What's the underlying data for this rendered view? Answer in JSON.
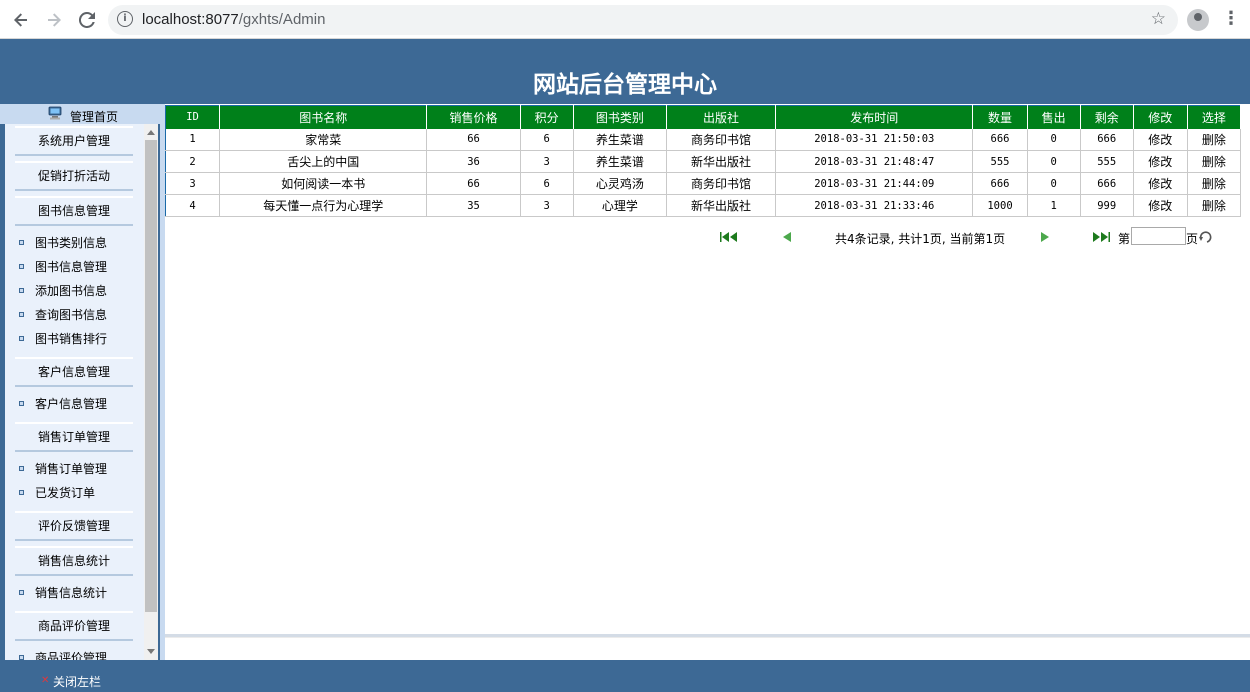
{
  "browser": {
    "url_host": "localhost:8077",
    "url_path": "/gxhts/Admin"
  },
  "header": {
    "title": "网站后台管理中心"
  },
  "sidebar": {
    "home_label": "管理首页",
    "entries": [
      {
        "type": "section",
        "label": "系统用户管理"
      },
      {
        "type": "section",
        "label": "促销打折活动"
      },
      {
        "type": "section",
        "label": "图书信息管理"
      },
      {
        "type": "item",
        "label": "图书类别信息"
      },
      {
        "type": "item",
        "label": "图书信息管理"
      },
      {
        "type": "item",
        "label": "添加图书信息"
      },
      {
        "type": "item",
        "label": "查询图书信息"
      },
      {
        "type": "item",
        "label": "图书销售排行"
      },
      {
        "type": "section",
        "label": "客户信息管理"
      },
      {
        "type": "item",
        "label": "客户信息管理"
      },
      {
        "type": "section",
        "label": "销售订单管理"
      },
      {
        "type": "item",
        "label": "销售订单管理"
      },
      {
        "type": "item",
        "label": "已发货订单"
      },
      {
        "type": "section",
        "label": "评价反馈管理"
      },
      {
        "type": "section",
        "label": "销售信息统计"
      },
      {
        "type": "item",
        "label": "销售信息统计"
      },
      {
        "type": "section",
        "label": "商品评价管理"
      },
      {
        "type": "item",
        "label": "商品评价管理"
      }
    ]
  },
  "table": {
    "columns": [
      "ID",
      "图书名称",
      "销售价格",
      "积分",
      "图书类别",
      "出版社",
      "发布时间",
      "数量",
      "售出",
      "剩余",
      "修改",
      "选择"
    ],
    "rows": [
      [
        "1",
        "家常菜",
        "66",
        "6",
        "养生菜谱",
        "商务印书馆",
        "2018-03-31 21:50:03",
        "666",
        "0",
        "666",
        "修改",
        "删除"
      ],
      [
        "2",
        "舌尖上的中国",
        "36",
        "3",
        "养生菜谱",
        "新华出版社",
        "2018-03-31 21:48:47",
        "555",
        "0",
        "555",
        "修改",
        "删除"
      ],
      [
        "3",
        "如何阅读一本书",
        "66",
        "6",
        "心灵鸡汤",
        "商务印书馆",
        "2018-03-31 21:44:09",
        "666",
        "0",
        "666",
        "修改",
        "删除"
      ],
      [
        "4",
        "每天懂一点行为心理学",
        "35",
        "3",
        "心理学",
        "新华出版社",
        "2018-03-31 21:33:46",
        "1000",
        "1",
        "999",
        "修改",
        "删除"
      ]
    ]
  },
  "pager": {
    "summary": "共4条记录, 共计1页, 当前第1页",
    "page_prefix": "第",
    "page_suffix": "页",
    "page_input": ""
  },
  "footer": {
    "close_sidebar": "关闭左栏"
  },
  "colors": {
    "header_blue": "#3d6995",
    "table_header_green": "#00801a",
    "sidebar_bg": "#eaf1fb"
  }
}
